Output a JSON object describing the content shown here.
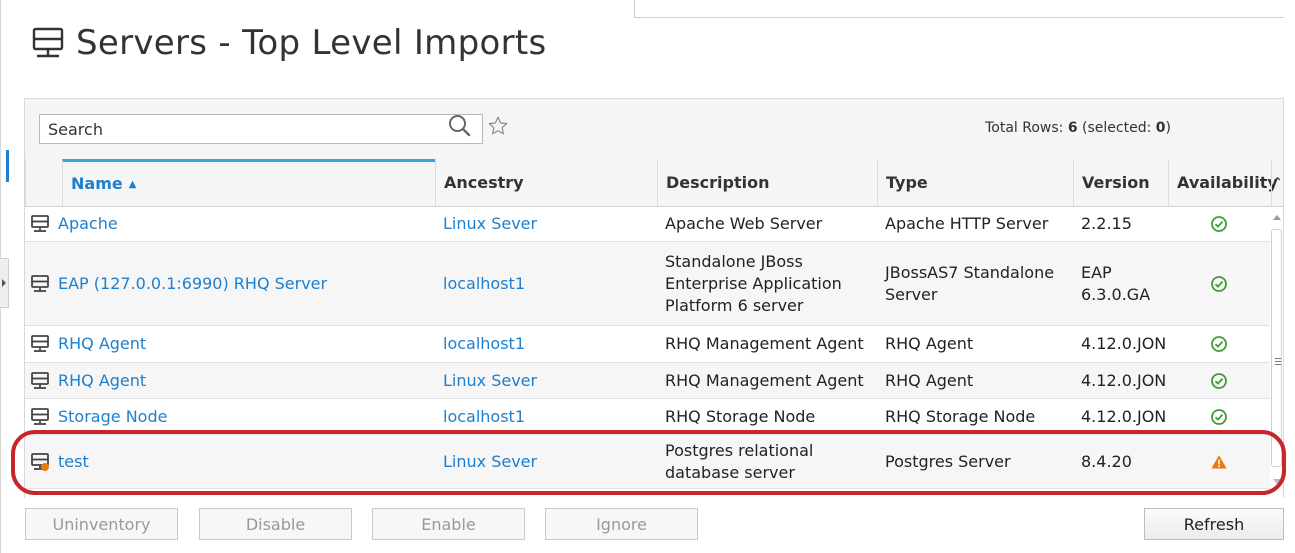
{
  "page": {
    "title": "Servers - Top Level Imports"
  },
  "toolbar": {
    "search_placeholder": "Search",
    "total_rows_label": "Total Rows:",
    "total_rows": "6",
    "selected_label": "selected:",
    "selected": "0"
  },
  "columns": {
    "name": "Name",
    "ancestry": "Ancestry",
    "description": "Description",
    "type": "Type",
    "version": "Version",
    "availability": "Availability"
  },
  "rows": [
    {
      "name": "Apache",
      "ancestry": "Linux Sever",
      "description": "Apache Web Server",
      "type": "Apache HTTP Server",
      "version": "2.2.15",
      "availability": "up"
    },
    {
      "name": "EAP (127.0.0.1:6990) RHQ Server",
      "ancestry": "localhost1",
      "description": "Standalone JBoss Enterprise Application Platform 6 server",
      "type": "JBossAS7 Standalone Server",
      "version": "EAP 6.3.0.GA",
      "availability": "up"
    },
    {
      "name": "RHQ Agent",
      "ancestry": "localhost1",
      "description": "RHQ Management Agent",
      "type": "RHQ Agent",
      "version": "4.12.0.JON",
      "availability": "up"
    },
    {
      "name": "RHQ Agent",
      "ancestry": "Linux Sever",
      "description": "RHQ Management Agent",
      "type": "RHQ Agent",
      "version": "4.12.0.JON",
      "availability": "up"
    },
    {
      "name": "Storage Node",
      "ancestry": "localhost1",
      "description": "RHQ Storage Node",
      "type": "RHQ Storage Node",
      "version": "4.12.0.JON",
      "availability": "up"
    },
    {
      "name": "test",
      "ancestry": "Linux Sever",
      "description": "Postgres relational database server",
      "type": "Postgres Server",
      "version": "8.4.20",
      "availability": "warning"
    }
  ],
  "buttons": {
    "uninventory": "Uninventory",
    "disable": "Disable",
    "enable": "Enable",
    "ignore": "Ignore",
    "refresh": "Refresh"
  },
  "icons": {
    "title": "server-icon",
    "search": "search-icon",
    "favorite": "star-icon",
    "row": "server-icon",
    "row_warning": "server-warning-icon",
    "up": "check-circle-icon",
    "warning": "warning-triangle-icon"
  },
  "colors": {
    "link": "#1d7fcf",
    "available": "#3f9c35",
    "warning": "#ec7a08",
    "highlight": "#c8262b"
  }
}
